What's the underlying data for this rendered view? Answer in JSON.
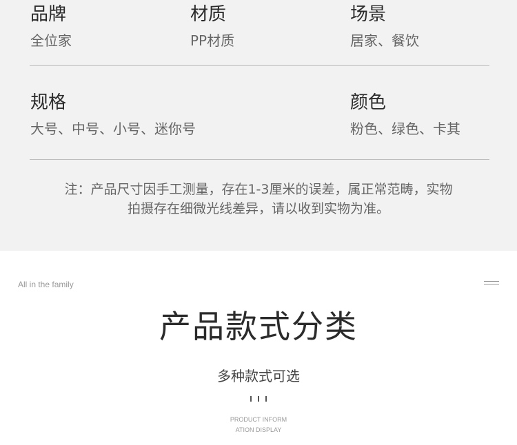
{
  "specs": [
    {
      "key": "品牌",
      "value": "全位家"
    },
    {
      "key": "材质",
      "value": "PP材质"
    },
    {
      "key": "场景",
      "value": "居家、餐饮"
    },
    {
      "key": "规格",
      "value": "大号、中号、小号、迷你号"
    },
    {
      "key": "颜色",
      "value": "粉色、绿色、卡其"
    }
  ],
  "note": {
    "line1": "注：产品尺寸因手工测量，存在1-3厘米的误差，属正常范畴，实物",
    "line2": "拍摄存在细微光线差异，请以收到实物为准。"
  },
  "section": {
    "tagline": "All in the family",
    "title": "产品款式分类",
    "subtitle": "多种款式可选",
    "en_line1": "PRODUCT INFORM",
    "en_line2": "ATION DISPLAY"
  },
  "colors": {
    "spec_bg": "#f2f2f2",
    "text_dark": "#2b2b2b",
    "text_muted": "#666666"
  }
}
